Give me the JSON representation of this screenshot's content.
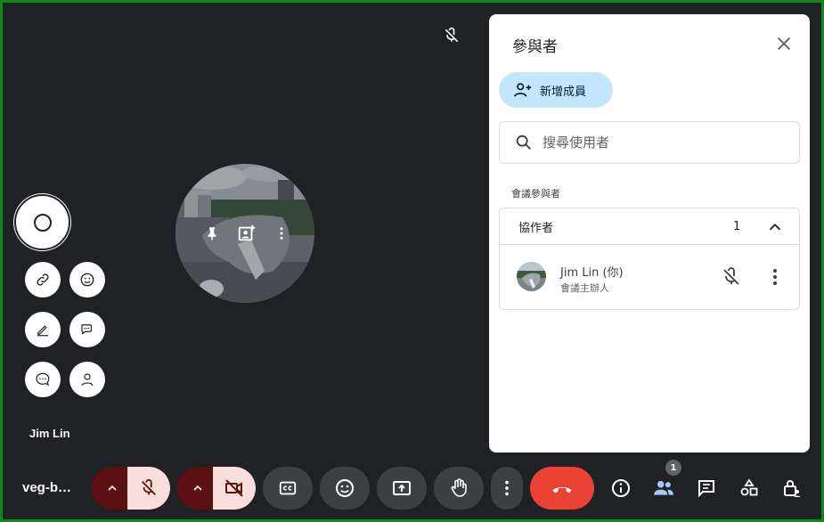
{
  "tile": {
    "name": "Jim Lin"
  },
  "panel": {
    "title": "參與者",
    "add_button_label": "新增成員",
    "search_placeholder": "搜尋使用者",
    "section_label": "會議參與者",
    "group": {
      "label": "協作者",
      "count": "1",
      "participants": [
        {
          "name": "Jim Lin (你)",
          "role": "會議主辦人"
        }
      ]
    }
  },
  "bottom_bar": {
    "meeting_code": "veg-b…",
    "participants_badge": "1"
  },
  "icons": {
    "mic": "mic-off-icon",
    "camera": "videocam-off-icon",
    "captions": "closed-caption-icon",
    "emoji": "emoji-icon",
    "present": "present-screen-icon",
    "raise_hand": "raise-hand-icon",
    "more": "more-vert-icon",
    "end_call": "call-end-icon",
    "info": "info-icon",
    "people": "people-icon",
    "chat": "chat-icon",
    "activities": "activities-icon",
    "host_controls": "lock-person-icon"
  },
  "colors": {
    "background": "#202124",
    "end_call": "#ea4335",
    "mic_off_bg": "#f9dedc",
    "add_button_bg": "#c2e7ff",
    "frame": "#0f8a16"
  }
}
